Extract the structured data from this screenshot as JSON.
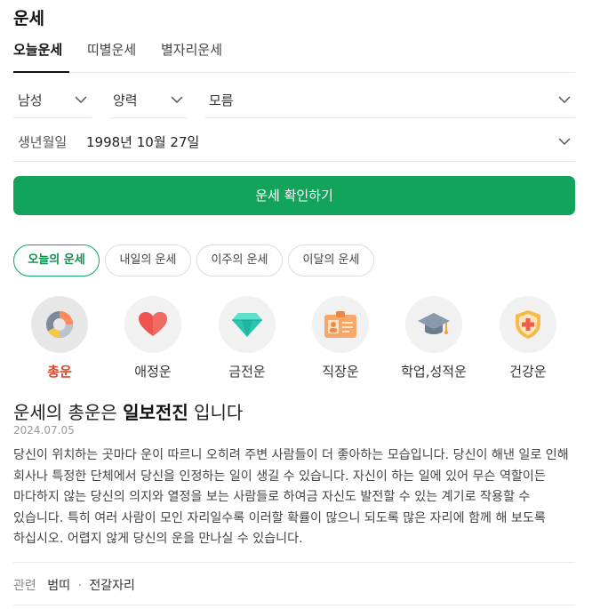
{
  "title": "운세",
  "tabs": [
    {
      "label": "오늘운세",
      "active": true
    },
    {
      "label": "띠별운세",
      "active": false
    },
    {
      "label": "별자리운세",
      "active": false
    }
  ],
  "form": {
    "gender": "남성",
    "calendar": "양력",
    "birth_time": "모름",
    "birth_label": "생년월일",
    "birth_value": "1998년 10월 27일",
    "submit_label": "운세 확인하기"
  },
  "period_pills": [
    {
      "label": "오늘의 운세",
      "active": true
    },
    {
      "label": "내일의 운세",
      "active": false
    },
    {
      "label": "이주의 운세",
      "active": false
    },
    {
      "label": "이달의 운세",
      "active": false
    }
  ],
  "categories": [
    {
      "label": "총운",
      "icon": "donut-chart-icon",
      "active": true
    },
    {
      "label": "애정운",
      "icon": "heart-icon",
      "active": false
    },
    {
      "label": "금전운",
      "icon": "gem-icon",
      "active": false
    },
    {
      "label": "직장운",
      "icon": "id-card-icon",
      "active": false
    },
    {
      "label": "학업,성적운",
      "icon": "graduation-cap-icon",
      "active": false
    },
    {
      "label": "건강운",
      "icon": "health-shield-icon",
      "active": false
    }
  ],
  "result": {
    "headline_prefix": "운세의 총운은",
    "headline_emphasis": "일보전진",
    "headline_suffix": "입니다",
    "date": "2024.07.05",
    "body": "당신이 위치하는 곳마다 운이 따르니 오히려 주변 사람들이 더 좋아하는 모습입니다. 당신이 해낸 일로 인해 회사나 특정한 단체에서 당신을 인정하는 일이 생길 수 있습니다. 자신이 하는 일에 있어 무슨 역할이든 마다하지 않는 당신의 의지와 열정을 보는 사람들로 하여금 자신도 발전할 수 있는 계기로 작용할 수 있습니다. 특히 여러 사람이 모인 자리일수록 이러할 확률이 많으니 되도록 많은 자리에 함께 해 보도록 하십시오. 어렵지 않게 당신의 운을 만나실 수 있습니다."
  },
  "related": {
    "label": "관련",
    "links": [
      "범띠",
      "전갈자리"
    ]
  },
  "colors": {
    "accent_green": "#12a45a",
    "active_category_red": "#e0452b"
  }
}
